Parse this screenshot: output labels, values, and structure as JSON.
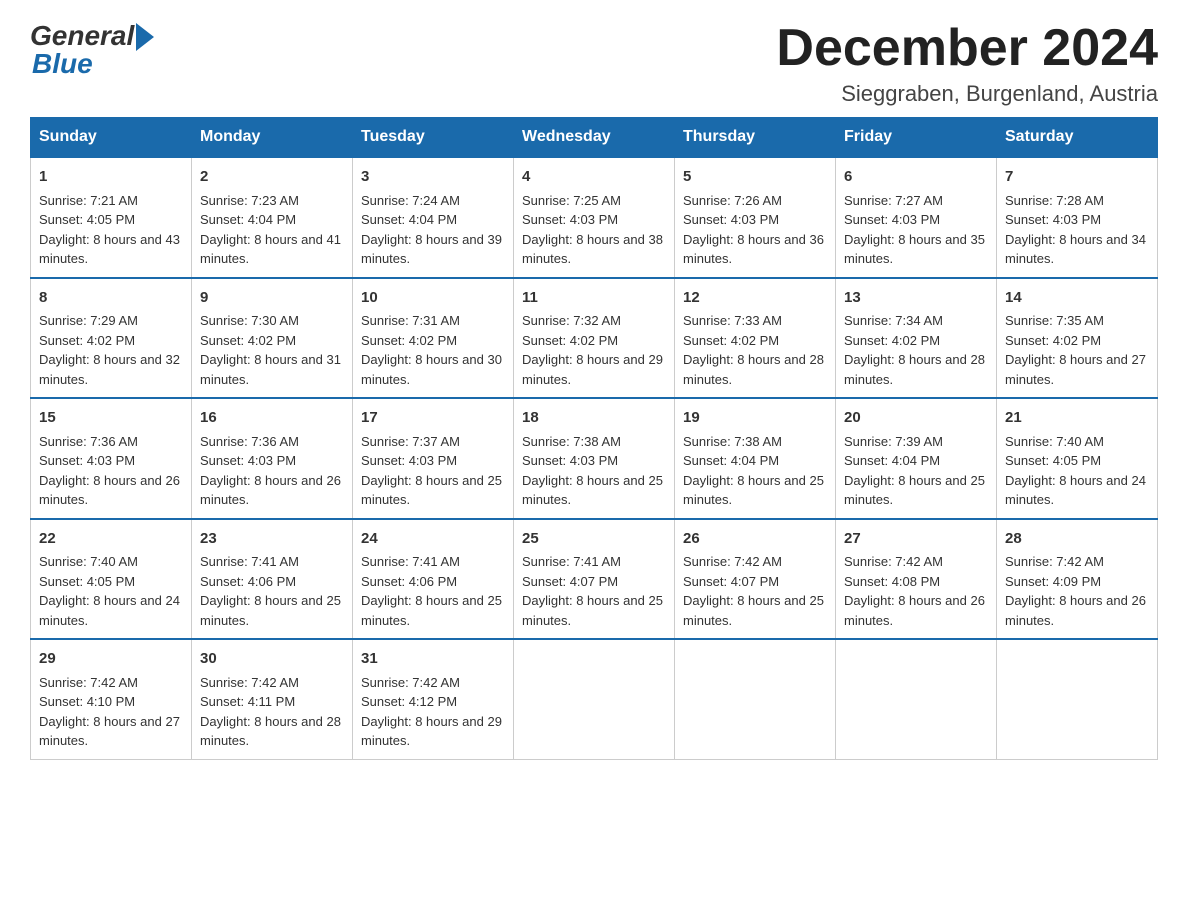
{
  "header": {
    "logo_general": "General",
    "logo_blue": "Blue",
    "month_title": "December 2024",
    "location": "Sieggraben, Burgenland, Austria"
  },
  "days_of_week": [
    "Sunday",
    "Monday",
    "Tuesday",
    "Wednesday",
    "Thursday",
    "Friday",
    "Saturday"
  ],
  "weeks": [
    [
      {
        "day": "1",
        "sunrise": "7:21 AM",
        "sunset": "4:05 PM",
        "daylight": "8 hours and 43 minutes."
      },
      {
        "day": "2",
        "sunrise": "7:23 AM",
        "sunset": "4:04 PM",
        "daylight": "8 hours and 41 minutes."
      },
      {
        "day": "3",
        "sunrise": "7:24 AM",
        "sunset": "4:04 PM",
        "daylight": "8 hours and 39 minutes."
      },
      {
        "day": "4",
        "sunrise": "7:25 AM",
        "sunset": "4:03 PM",
        "daylight": "8 hours and 38 minutes."
      },
      {
        "day": "5",
        "sunrise": "7:26 AM",
        "sunset": "4:03 PM",
        "daylight": "8 hours and 36 minutes."
      },
      {
        "day": "6",
        "sunrise": "7:27 AM",
        "sunset": "4:03 PM",
        "daylight": "8 hours and 35 minutes."
      },
      {
        "day": "7",
        "sunrise": "7:28 AM",
        "sunset": "4:03 PM",
        "daylight": "8 hours and 34 minutes."
      }
    ],
    [
      {
        "day": "8",
        "sunrise": "7:29 AM",
        "sunset": "4:02 PM",
        "daylight": "8 hours and 32 minutes."
      },
      {
        "day": "9",
        "sunrise": "7:30 AM",
        "sunset": "4:02 PM",
        "daylight": "8 hours and 31 minutes."
      },
      {
        "day": "10",
        "sunrise": "7:31 AM",
        "sunset": "4:02 PM",
        "daylight": "8 hours and 30 minutes."
      },
      {
        "day": "11",
        "sunrise": "7:32 AM",
        "sunset": "4:02 PM",
        "daylight": "8 hours and 29 minutes."
      },
      {
        "day": "12",
        "sunrise": "7:33 AM",
        "sunset": "4:02 PM",
        "daylight": "8 hours and 28 minutes."
      },
      {
        "day": "13",
        "sunrise": "7:34 AM",
        "sunset": "4:02 PM",
        "daylight": "8 hours and 28 minutes."
      },
      {
        "day": "14",
        "sunrise": "7:35 AM",
        "sunset": "4:02 PM",
        "daylight": "8 hours and 27 minutes."
      }
    ],
    [
      {
        "day": "15",
        "sunrise": "7:36 AM",
        "sunset": "4:03 PM",
        "daylight": "8 hours and 26 minutes."
      },
      {
        "day": "16",
        "sunrise": "7:36 AM",
        "sunset": "4:03 PM",
        "daylight": "8 hours and 26 minutes."
      },
      {
        "day": "17",
        "sunrise": "7:37 AM",
        "sunset": "4:03 PM",
        "daylight": "8 hours and 25 minutes."
      },
      {
        "day": "18",
        "sunrise": "7:38 AM",
        "sunset": "4:03 PM",
        "daylight": "8 hours and 25 minutes."
      },
      {
        "day": "19",
        "sunrise": "7:38 AM",
        "sunset": "4:04 PM",
        "daylight": "8 hours and 25 minutes."
      },
      {
        "day": "20",
        "sunrise": "7:39 AM",
        "sunset": "4:04 PM",
        "daylight": "8 hours and 25 minutes."
      },
      {
        "day": "21",
        "sunrise": "7:40 AM",
        "sunset": "4:05 PM",
        "daylight": "8 hours and 24 minutes."
      }
    ],
    [
      {
        "day": "22",
        "sunrise": "7:40 AM",
        "sunset": "4:05 PM",
        "daylight": "8 hours and 24 minutes."
      },
      {
        "day": "23",
        "sunrise": "7:41 AM",
        "sunset": "4:06 PM",
        "daylight": "8 hours and 25 minutes."
      },
      {
        "day": "24",
        "sunrise": "7:41 AM",
        "sunset": "4:06 PM",
        "daylight": "8 hours and 25 minutes."
      },
      {
        "day": "25",
        "sunrise": "7:41 AM",
        "sunset": "4:07 PM",
        "daylight": "8 hours and 25 minutes."
      },
      {
        "day": "26",
        "sunrise": "7:42 AM",
        "sunset": "4:07 PM",
        "daylight": "8 hours and 25 minutes."
      },
      {
        "day": "27",
        "sunrise": "7:42 AM",
        "sunset": "4:08 PM",
        "daylight": "8 hours and 26 minutes."
      },
      {
        "day": "28",
        "sunrise": "7:42 AM",
        "sunset": "4:09 PM",
        "daylight": "8 hours and 26 minutes."
      }
    ],
    [
      {
        "day": "29",
        "sunrise": "7:42 AM",
        "sunset": "4:10 PM",
        "daylight": "8 hours and 27 minutes."
      },
      {
        "day": "30",
        "sunrise": "7:42 AM",
        "sunset": "4:11 PM",
        "daylight": "8 hours and 28 minutes."
      },
      {
        "day": "31",
        "sunrise": "7:42 AM",
        "sunset": "4:12 PM",
        "daylight": "8 hours and 29 minutes."
      },
      null,
      null,
      null,
      null
    ]
  ]
}
